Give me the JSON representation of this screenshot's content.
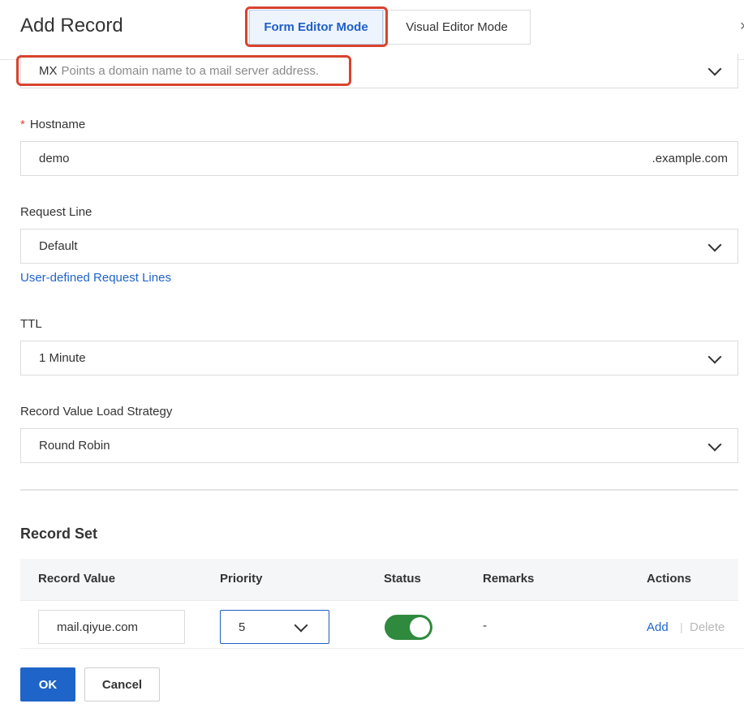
{
  "dialog": {
    "title": "Add Record",
    "close_glyph": "×"
  },
  "modes": {
    "form": "Form Editor Mode",
    "visual": "Visual Editor Mode",
    "selected": "Form Editor Mode"
  },
  "record_type": {
    "code": "MX",
    "description": "Points a domain name to a mail server address."
  },
  "hostname": {
    "required_mark": "*",
    "label": "Hostname",
    "value": "demo",
    "suffix": ".example.com"
  },
  "request_line": {
    "label": "Request Line",
    "value": "Default",
    "link": "User-defined Request Lines"
  },
  "ttl": {
    "label": "TTL",
    "value": "1 Minute"
  },
  "load_strategy": {
    "label": "Record Value Load Strategy",
    "value": "Round Robin"
  },
  "record_set": {
    "title": "Record Set",
    "columns": [
      "Record Value",
      "Priority",
      "Status",
      "Remarks",
      "Actions"
    ],
    "rows": [
      {
        "value": "mail.qiyue.com",
        "priority": "5",
        "status_on": true,
        "remarks": "-",
        "add": "Add",
        "separator": "|",
        "delete": "Delete"
      }
    ]
  },
  "footer": {
    "ok": "OK",
    "cancel": "Cancel"
  },
  "colors": {
    "accent": "#1f64c8",
    "highlight": "#d9432f",
    "toggle_on": "#2f8a3e",
    "required": "#e0453a"
  },
  "icons": {
    "dropdown": "chevron-down-icon",
    "close": "close-icon"
  }
}
